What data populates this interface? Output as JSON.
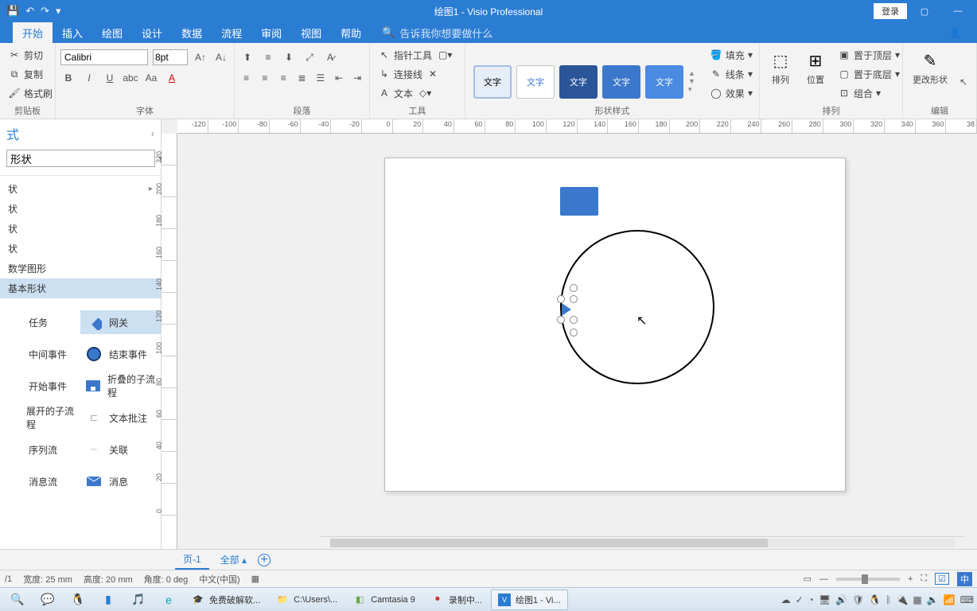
{
  "title": {
    "doc": "绘图1",
    "app": "Visio Professional",
    "full": "绘图1  -  Visio Professional"
  },
  "title_buttons": {
    "login": "登录"
  },
  "tabs": [
    "开始",
    "插入",
    "绘图",
    "设计",
    "数据",
    "流程",
    "审阅",
    "视图",
    "帮助"
  ],
  "tell_me": "告诉我你想要做什么",
  "clipboard": {
    "cut": "剪切",
    "copy": "复制",
    "paint": "格式刷",
    "label": "剪贴板"
  },
  "font": {
    "name": "Calibri",
    "size": "8pt",
    "label": "字体"
  },
  "paragraph": {
    "label": "段落"
  },
  "tools": {
    "pointer": "指针工具",
    "connector": "连接线",
    "text": "文本",
    "label": "工具"
  },
  "styles": {
    "text": "文字",
    "label": "形状样式",
    "fill": "填充",
    "line": "线条",
    "effect": "效果"
  },
  "arrange": {
    "arrange": "排列",
    "position": "位置",
    "top": "置于顶层",
    "bottom": "置于底层",
    "group": "组合",
    "label": "排列"
  },
  "edit": {
    "change_shape": "更改形状",
    "label": "编辑"
  },
  "shapes_pane": {
    "title": "式",
    "search_placeholder": "形状",
    "categories": [
      "状",
      "状",
      "状",
      "状",
      "数学图形",
      "基本形状"
    ],
    "selected_cat": 5,
    "shapes": [
      [
        "任务",
        "网关"
      ],
      [
        "中间事件",
        "结束事件"
      ],
      [
        "开始事件",
        "折叠的子流程"
      ],
      [
        "展开的子流程",
        "文本批注"
      ],
      [
        "序列流",
        "关联"
      ],
      [
        "消息流",
        "消息"
      ]
    ],
    "selected_shape": "网关"
  },
  "ruler_h": [
    "-120",
    "-100",
    "-80",
    "-60",
    "-40",
    "-20",
    "0",
    "20",
    "40",
    "60",
    "80",
    "100",
    "120",
    "140",
    "160",
    "180",
    "200",
    "220",
    "240",
    "260",
    "280",
    "300",
    "320",
    "340",
    "360",
    "38"
  ],
  "ruler_v": [
    "220",
    "200",
    "180",
    "160",
    "140",
    "120",
    "100",
    "80",
    "60",
    "40",
    "20",
    "0"
  ],
  "page_tabs": {
    "page1": "页-1",
    "all": "全部"
  },
  "status": {
    "page": "/1",
    "width": "宽度: 25 mm",
    "height": "高度: 20 mm",
    "angle": "角度: 0 deg",
    "lang": "中文(中国)",
    "ime": "中"
  },
  "taskbar": {
    "items": [
      {
        "label": "免费破解软..."
      },
      {
        "label": "C:\\Users\\..."
      },
      {
        "label": "Camtasia 9"
      },
      {
        "label": "录制中..."
      },
      {
        "label": "绘图1 - Vi..."
      }
    ]
  },
  "colors": {
    "accent": "#2b7cd3",
    "shape_blue": "#3b78cc"
  }
}
